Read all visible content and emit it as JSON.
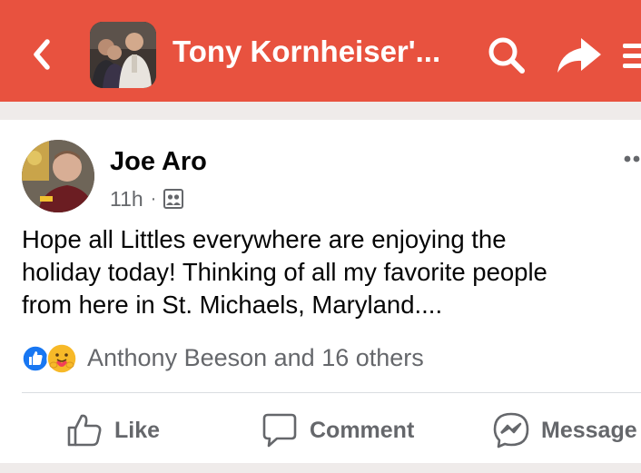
{
  "header": {
    "title": "Tony Kornheiser'...",
    "icons": {
      "back": "chevron-left-icon",
      "search": "search-icon",
      "share": "share-arrow-icon",
      "menu": "hamburger-menu-icon"
    },
    "accent_color": "#e8523f"
  },
  "post": {
    "author": "Joe Aro",
    "time": "11h",
    "separator": "·",
    "audience_icon": "group-members-icon",
    "text_lines": [
      "Hope all Littles everywhere are enjoying the",
      "holiday today! Thinking of all my favorite people",
      "from here in St. Michaels, Maryland...."
    ],
    "reactions": {
      "types": [
        "like-reaction-icon",
        "care-reaction-icon"
      ],
      "summary": "Anthony Beeson and 16 others"
    },
    "actions": [
      {
        "label": "Like",
        "icon": "thumbs-up-icon"
      },
      {
        "label": "Comment",
        "icon": "comment-bubble-icon"
      },
      {
        "label": "Message",
        "icon": "messenger-icon"
      }
    ]
  }
}
